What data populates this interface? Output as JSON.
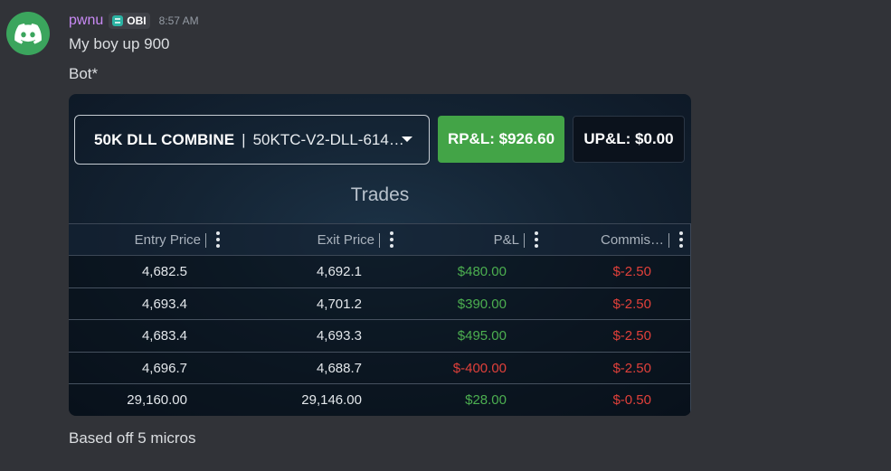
{
  "message": {
    "username": "pwnu",
    "tag": "OBI",
    "timestamp": "8:57 AM",
    "lines": [
      "My boy up 900",
      "Bot*"
    ],
    "footer_text": "Based off 5 micros"
  },
  "embed": {
    "account_name": "50K DLL COMBINE",
    "separator": "|",
    "account_id": "50KTC-V2-DLL-614…",
    "rpl_label": "RP&L: $926.60",
    "upl_label": "UP&L: $0.00",
    "trades_title": "Trades",
    "columns": [
      "Entry Price",
      "Exit Price",
      "P&L",
      "Commis…"
    ],
    "rows": [
      {
        "entry": "4,682.5",
        "exit": "4,692.1",
        "pnl": "$480.00",
        "commission": "$-2.50"
      },
      {
        "entry": "4,693.4",
        "exit": "4,701.2",
        "pnl": "$390.00",
        "commission": "$-2.50"
      },
      {
        "entry": "4,683.4",
        "exit": "4,693.3",
        "pnl": "$495.00",
        "commission": "$-2.50"
      },
      {
        "entry": "4,696.7",
        "exit": "4,688.7",
        "pnl": "$-400.00",
        "commission": "$-2.50"
      },
      {
        "entry": "29,160.00",
        "exit": "29,146.00",
        "pnl": "$28.00",
        "commission": "$-0.50"
      }
    ]
  },
  "colors": {
    "positive": "#4caf50",
    "negative": "#e0403a",
    "rpl_button": "#43a447",
    "username": "#c98af5"
  }
}
